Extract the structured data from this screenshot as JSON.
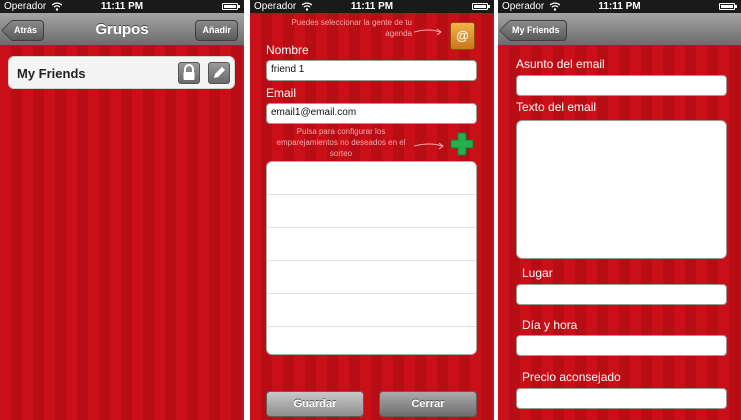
{
  "status": {
    "carrier": "Operador",
    "time": "11:11 PM"
  },
  "screen1": {
    "nav_title": "Grupos",
    "back_label": "Atrás",
    "add_label": "Añadir",
    "groups": [
      {
        "name": "My Friends"
      }
    ]
  },
  "screen2": {
    "contacts_hint": "Puedes seleccionar la gente de tu agenda",
    "name_label": "Nombre",
    "name_value": "friend 1",
    "email_label": "Email",
    "email_value": "email1@email.com",
    "pairing_hint": "Pulsa para configurar los emparejamientos no deseados en el sorteo",
    "save_label": "Guardar",
    "close_label": "Cerrar"
  },
  "screen3": {
    "back_label": "My Friends",
    "subject_label": "Asunto del email",
    "body_label": "Texto del email",
    "place_label": "Lugar",
    "datetime_label": "Día y hora",
    "price_label": "Precio aconsejado"
  },
  "colors": {
    "background_red": "#c0121a",
    "add_green": "#22b14c"
  }
}
